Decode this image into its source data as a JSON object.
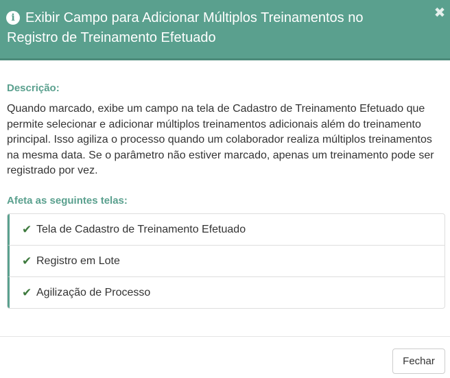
{
  "header": {
    "icon": "info-circle-icon",
    "title": "Exibir Campo para Adicionar Múltiplos Treinamentos no Registro de Treinamento Efetuado",
    "close_icon": "close-icon",
    "color": "#5aa08e"
  },
  "description": {
    "label": "Descrição:",
    "text": "Quando marcado, exibe um campo na tela de Cadastro de Treinamento Efetuado que permite selecionar e adicionar múltiplos treinamentos adicionais além do treinamento principal. Isso agiliza o processo quando um colaborador realiza múltiplos treinamentos na mesma data. Se o parâmetro não estiver marcado, apenas um treinamento pode ser registrado por vez."
  },
  "affects": {
    "label": "Afeta as seguintes telas:",
    "items": [
      {
        "icon": "check-icon",
        "label": "Tela de Cadastro de Treinamento Efetuado"
      },
      {
        "icon": "check-icon",
        "label": "Registro em Lote"
      },
      {
        "icon": "check-icon",
        "label": "Agilização de Processo"
      }
    ],
    "check_color": "#3e7a3e"
  },
  "footer": {
    "close_label": "Fechar"
  }
}
